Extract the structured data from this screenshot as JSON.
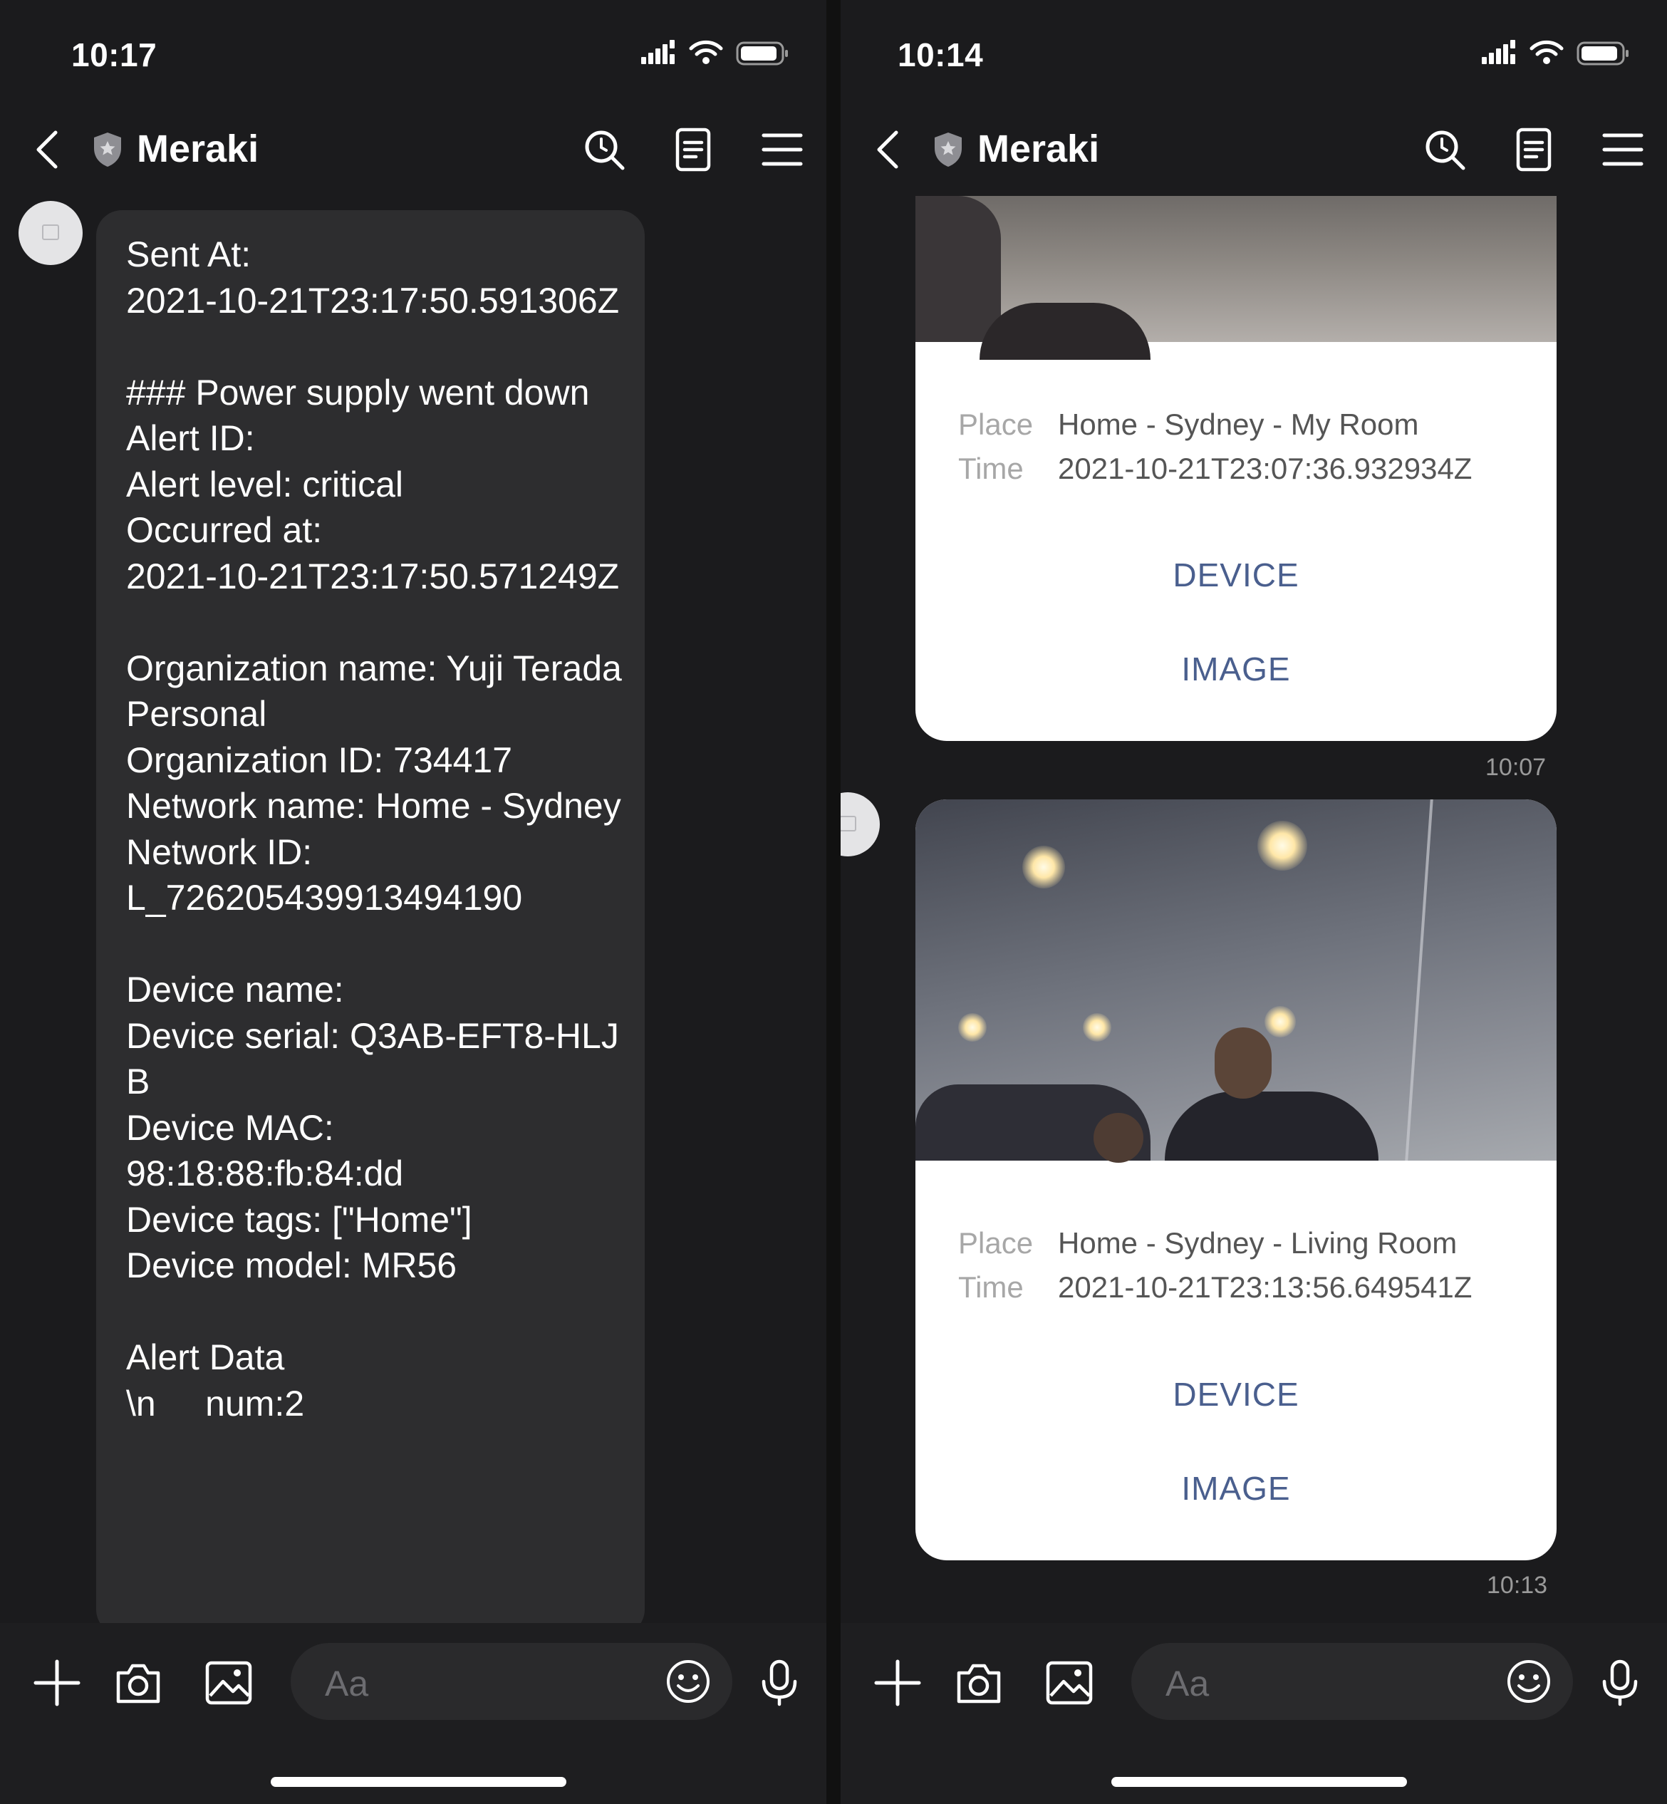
{
  "left": {
    "status_time": "10:17",
    "header": {
      "title": "Meraki"
    },
    "message": {
      "text": "Sent At:\n2021-10-21T23:17:50.591306Z\n\n### Power supply went down\nAlert ID:\nAlert level: critical\nOccurred at:\n2021-10-21T23:17:50.571249Z\n\nOrganization name: Yuji Terada Personal\nOrganization ID: 734417\nNetwork name: Home - Sydney\nNetwork ID:\nL_726205439913494190\n\nDevice name:\nDevice serial: Q3AB-EFT8-HLJB\nDevice MAC:\n98:18:88:fb:84:dd\nDevice tags: [\"Home\"]\nDevice model: MR56\n\nAlert Data\n\\n     num:2"
    },
    "input": {
      "placeholder": "Aa"
    }
  },
  "right": {
    "status_time": "10:14",
    "header": {
      "title": "Meraki"
    },
    "cards": [
      {
        "place_label": "Place",
        "place_value": "Home - Sydney - My Room",
        "time_label": "Time",
        "time_value": "2021-10-21T23:07:36.932934Z",
        "device_label": "DEVICE",
        "image_label": "IMAGE",
        "sent_time": "10:07"
      },
      {
        "place_label": "Place",
        "place_value": "Home - Sydney - Living Room",
        "time_label": "Time",
        "time_value": "2021-10-21T23:13:56.649541Z",
        "device_label": "DEVICE",
        "image_label": "IMAGE",
        "sent_time": "10:13"
      }
    ],
    "input": {
      "placeholder": "Aa"
    }
  },
  "icons": {
    "back": "chevron-left-icon",
    "verified": "shield-icon",
    "search": "search-icon",
    "notes": "notes-icon",
    "menu": "menu-icon",
    "plus": "plus-icon",
    "camera": "camera-icon",
    "gallery": "image-icon",
    "emoji": "emoji-icon",
    "mic": "microphone-icon"
  },
  "colors": {
    "background": "#1b1b1d",
    "bubble": "#2d2d2f",
    "card": "#ffffff",
    "link": "#4a5f8e"
  }
}
